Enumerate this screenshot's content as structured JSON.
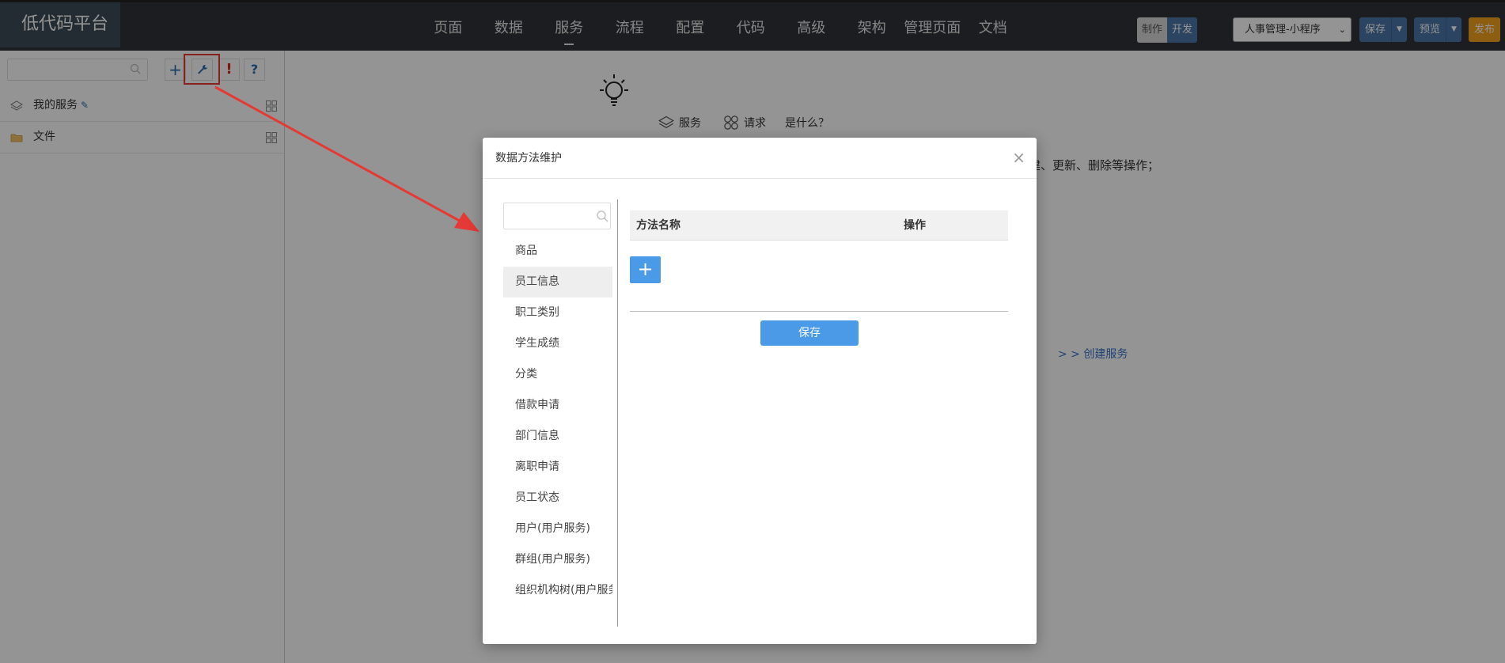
{
  "app": {
    "title": "低代码平台"
  },
  "nav": {
    "items": [
      "页面",
      "数据",
      "服务",
      "流程",
      "配置",
      "代码",
      "高级",
      "架构",
      "管理页面",
      "文档"
    ],
    "active_index": 2
  },
  "mode": {
    "make": "制作",
    "dev": "开发"
  },
  "project": {
    "selected": "人事管理-小程序"
  },
  "actions": {
    "save": "保存",
    "preview": "预览",
    "publish": "发布"
  },
  "sidebar": {
    "search_placeholder": "",
    "tree": [
      {
        "label": "我的服务",
        "icon": "layers-icon"
      },
      {
        "label": "文件",
        "icon": "folder-icon"
      }
    ]
  },
  "main": {
    "tabs": [
      {
        "label": "服务",
        "icon": "layers-icon"
      },
      {
        "label": "请求",
        "icon": "grid-icon"
      },
      {
        "label": "是什么？"
      }
    ],
    "description": "建、更新、删除等操作；",
    "create_link": "> > 创建服务"
  },
  "modal": {
    "title": "数据方法维护",
    "close": "×",
    "entity_search_placeholder": "",
    "entities": [
      "商品",
      "员工信息",
      "职工类别",
      "学生成绩",
      "分类",
      "借款申请",
      "部门信息",
      "离职申请",
      "员工状态",
      "用户(用户服务)",
      "群组(用户服务)",
      "组织机构树(用户服务)"
    ],
    "selected_entity_index": 1,
    "table": {
      "col_name": "方法名称",
      "col_action": "操作",
      "add_button": "+"
    },
    "save_button": "保存"
  },
  "colors": {
    "accent": "#4a9ae8",
    "topbar": "#2f3237",
    "highlight": "#e53935"
  }
}
